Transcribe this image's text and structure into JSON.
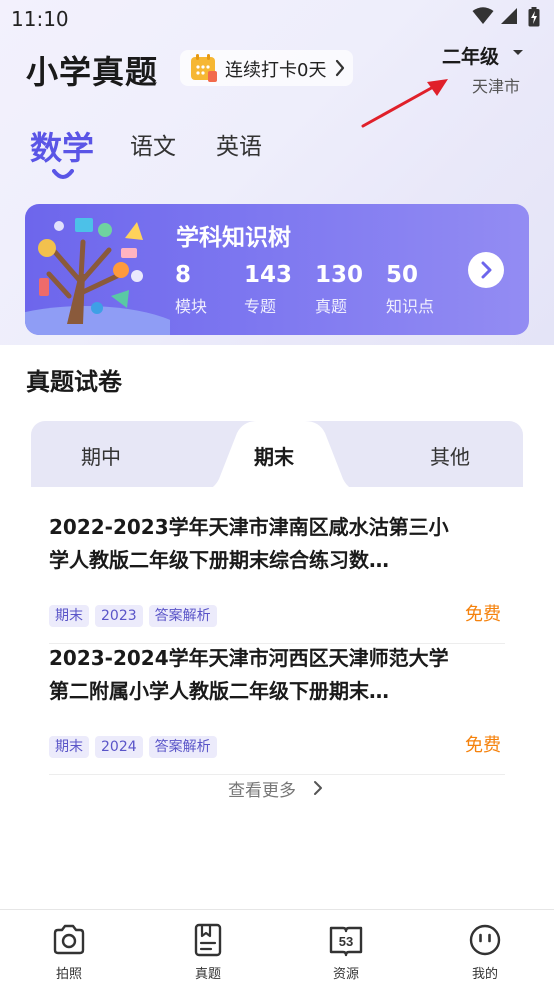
{
  "status_bar": {
    "time": "11:10"
  },
  "header": {
    "app_title": "小学真题",
    "checkin_label": "连续打卡0天",
    "grade": "二年级",
    "city": "天津市"
  },
  "subject_tabs": [
    {
      "label": "数学",
      "active": true
    },
    {
      "label": "语文",
      "active": false
    },
    {
      "label": "英语",
      "active": false
    }
  ],
  "knowledge_card": {
    "title": "学科知识树",
    "stats": [
      {
        "value": "8",
        "label": "模块"
      },
      {
        "value": "143",
        "label": "专题"
      },
      {
        "value": "130",
        "label": "真题"
      },
      {
        "value": "50",
        "label": "知识点"
      }
    ]
  },
  "papers_section": {
    "title": "真题试卷",
    "tabs": [
      {
        "label": "期中",
        "active": false
      },
      {
        "label": "期末",
        "active": true
      },
      {
        "label": "其他",
        "active": false
      }
    ],
    "items": [
      {
        "title": "2022-2023学年天津市津南区咸水沽第三小学人教版二年级下册期末综合练习数…",
        "tags": [
          "期末",
          "2023",
          "答案解析"
        ],
        "price": "免费"
      },
      {
        "title": "2023-2024学年天津市河西区天津师范大学第二附属小学人教版二年级下册期末…",
        "tags": [
          "期末",
          "2024",
          "答案解析"
        ],
        "price": "免费"
      }
    ],
    "more_label": "查看更多"
  },
  "bottom_nav": [
    {
      "label": "拍照",
      "icon": "camera-icon"
    },
    {
      "label": "真题",
      "icon": "paper-icon"
    },
    {
      "label": "资源",
      "icon": "book-53-icon"
    },
    {
      "label": "我的",
      "icon": "face-icon"
    }
  ],
  "colors": {
    "accent": "#5a55e6",
    "card_gradient_start": "#6d66ec",
    "price": "#f5820d",
    "annotation_arrow": "#e0202a"
  }
}
